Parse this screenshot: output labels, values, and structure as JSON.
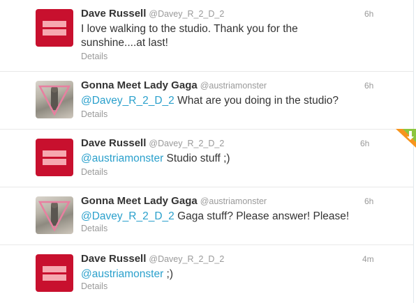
{
  "tweets": [
    {
      "name": "Dave Russell",
      "handle": "@Davey_R_2_D_2",
      "time": "6h",
      "mention": "",
      "text": "I love walking to the studio. Thank you for the",
      "text2": "sunshine....at last!",
      "details": "Details",
      "avatar": "equality-icon"
    },
    {
      "name": "Gonna Meet Lady Gaga",
      "handle": "@austriamonster",
      "time": "6h",
      "mention": "@Davey_R_2_D_2",
      "text": " What are you doing in the studio?",
      "details": "Details",
      "avatar": "photo"
    },
    {
      "name": "Dave Russell",
      "handle": "@Davey_R_2_D_2",
      "time": "6h",
      "mention": "@austriamonster",
      "text": " Studio stuff ;)",
      "details": "Details",
      "avatar": "equality-icon"
    },
    {
      "name": "Gonna Meet Lady Gaga",
      "handle": "@austriamonster",
      "time": "6h",
      "mention": "@Davey_R_2_D_2",
      "text": " Gaga stuff? Please answer! Please!",
      "details": "Details",
      "avatar": "photo"
    },
    {
      "name": "Dave Russell",
      "handle": "@Davey_R_2_D_2",
      "time": "4m",
      "mention": "@austriamonster",
      "text": " ;)",
      "details": "Details",
      "avatar": "equality-icon"
    }
  ],
  "colors": {
    "mention": "#2aa0cc",
    "name": "#333333",
    "meta": "#999999",
    "avatar_red": "#c8102e"
  }
}
